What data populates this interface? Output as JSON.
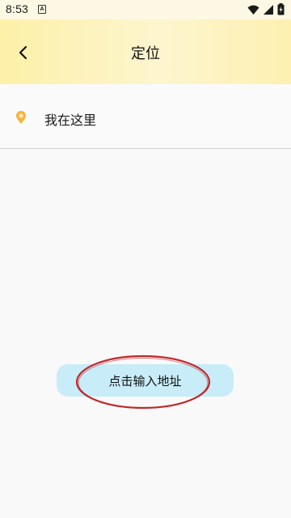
{
  "status_bar": {
    "time": "8:53",
    "notification_badge": "A",
    "icons": [
      "wifi-icon",
      "signal-icon",
      "battery-icon"
    ]
  },
  "header": {
    "title": "定位",
    "back_icon": "chevron-left-icon"
  },
  "location": {
    "icon": "location-pin-icon",
    "label": "我在这里"
  },
  "actions": {
    "input_address_label": "点击输入地址"
  },
  "colors": {
    "header_gradient_start": "#fdf0a8",
    "header_gradient_end": "#fdf5cf",
    "pin": "#f6b23a",
    "button_bg": "#c8ecf8",
    "annotation": "#c0282b"
  }
}
